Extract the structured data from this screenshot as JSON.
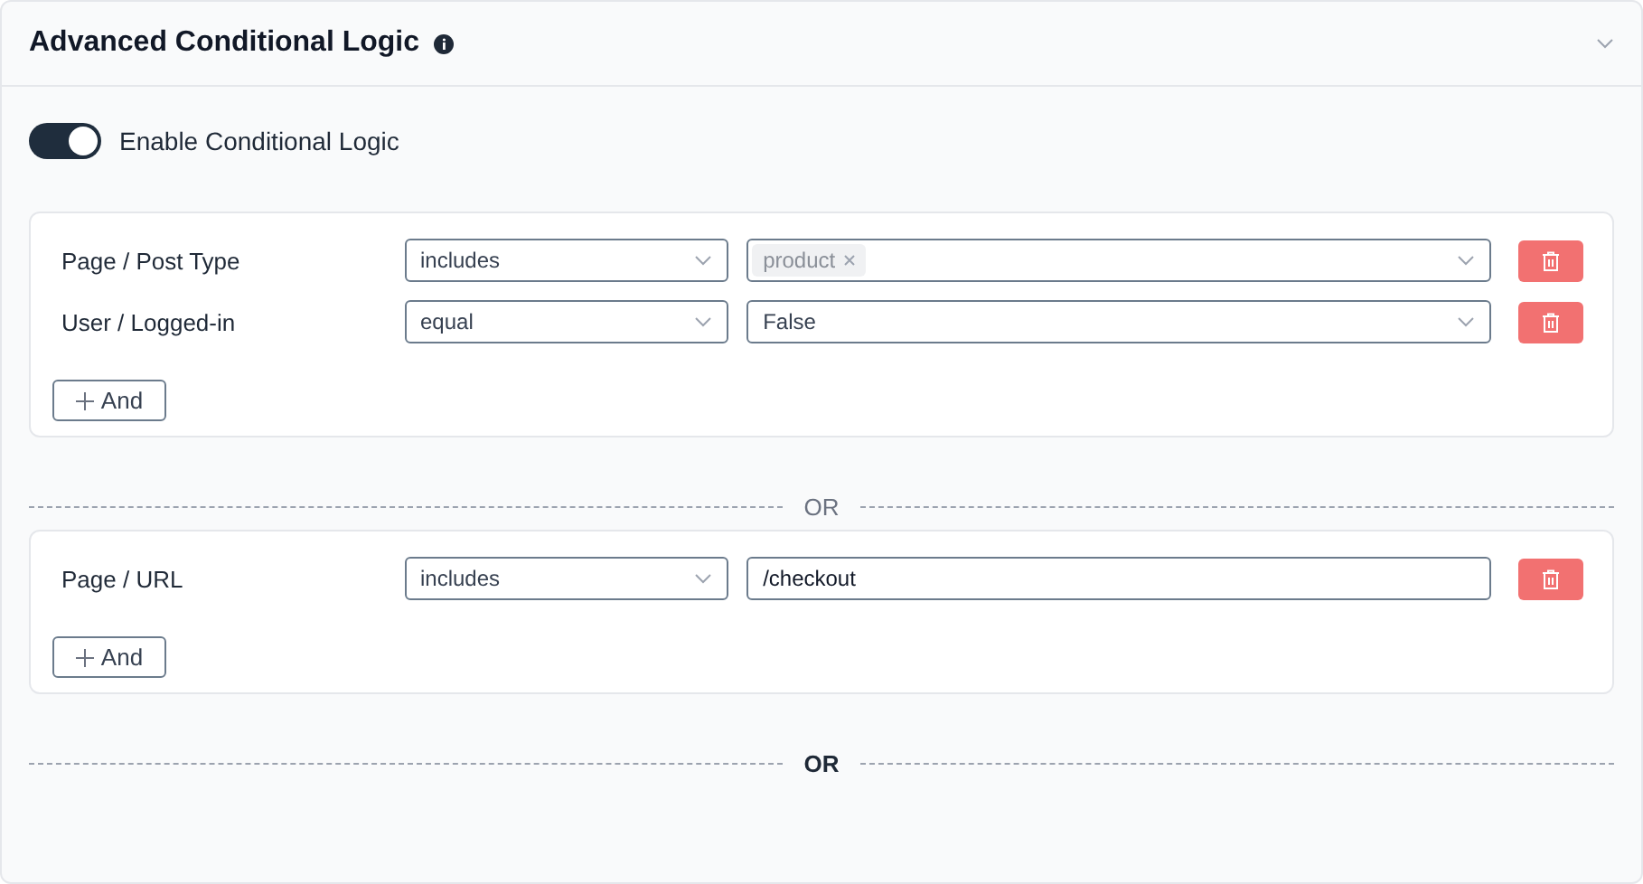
{
  "panel": {
    "title": "Advanced Conditional Logic",
    "expanded": true
  },
  "toggle": {
    "label": "Enable Conditional Logic",
    "on": true
  },
  "groups": [
    {
      "rules": [
        {
          "field": "Page / Post Type",
          "operator": "includes",
          "value": {
            "kind": "tags",
            "tags": [
              "product"
            ]
          }
        },
        {
          "field": "User / Logged-in",
          "operator": "equal",
          "value": {
            "kind": "select",
            "text": "False"
          }
        }
      ],
      "add_label": "And"
    },
    {
      "rules": [
        {
          "field": "Page / URL",
          "operator": "includes",
          "value": {
            "kind": "text",
            "text": "/checkout"
          }
        }
      ],
      "add_label": "And"
    }
  ],
  "separators": [
    {
      "label": "OR",
      "active": false
    },
    {
      "label": "OR",
      "active": true
    }
  ]
}
